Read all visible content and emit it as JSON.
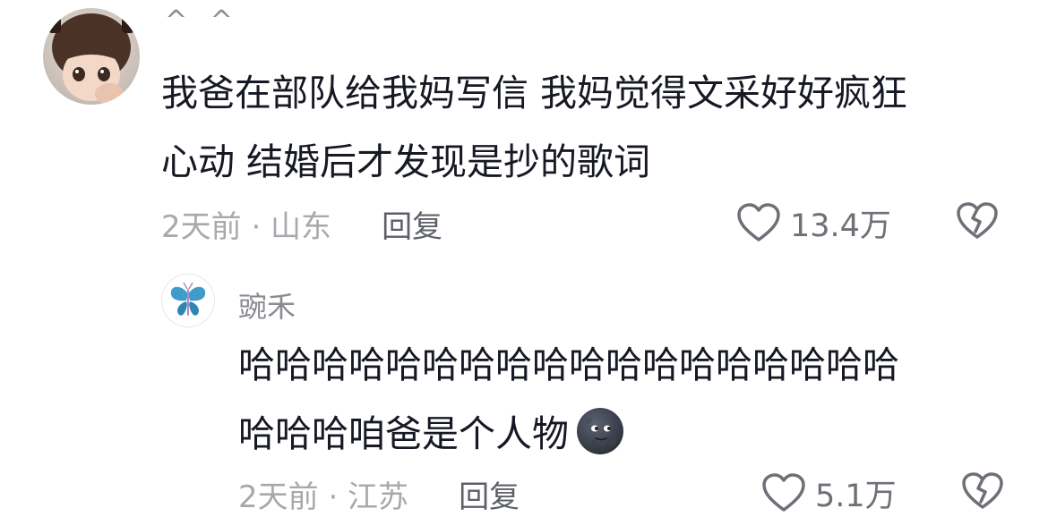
{
  "comments": [
    {
      "username": "^ ^",
      "text_lines": [
        "我爸在部队给我妈写信 我妈觉得文采好好疯狂",
        "心动 结婚后才发现是抄的歌词"
      ],
      "time": "2天前 · 山东",
      "reply_label": "回复",
      "likes": "13.4万"
    },
    {
      "username": "豌禾",
      "text_lines": [
        "哈哈哈哈哈哈哈哈哈哈哈哈哈哈哈哈哈哈",
        "哈哈哈咱爸是个人物"
      ],
      "emoji": "new-moon-face",
      "time": "2天前 · 江苏",
      "reply_label": "回复",
      "likes": "5.1万"
    }
  ],
  "colors": {
    "text_primary": "#161823",
    "text_secondary": "#8a8b91",
    "reply": "#5e6068",
    "icon": "#6f7077"
  },
  "icons": [
    "heart-outline-icon",
    "broken-heart-icon",
    "new-moon-face-emoji"
  ]
}
